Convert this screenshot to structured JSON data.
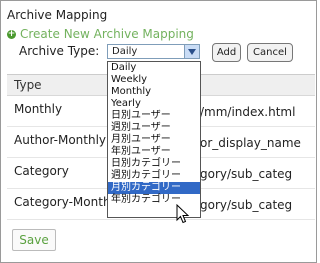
{
  "page": {
    "title": "Archive Mapping",
    "create_link": "Create New Archive Mapping"
  },
  "form": {
    "archive_type_label": "Archive Type:",
    "selected_value": "Daily",
    "add_label": "Add",
    "cancel_label": "Cancel"
  },
  "dropdown": {
    "options": [
      "Daily",
      "Weekly",
      "Monthly",
      "Yearly",
      "日別ユーザー",
      "週別ユーザー",
      "月別ユーザー",
      "年別ユーザー",
      "日別カテゴリー",
      "週別カテゴリー",
      "月別カテゴリー",
      "年別カテゴリー"
    ],
    "highlighted_index": 10
  },
  "table": {
    "header_type": "Type",
    "rows": [
      {
        "type": "Monthly",
        "path": "/mm/index.html"
      },
      {
        "type": "Author-Monthly",
        "path": "or_display_name"
      },
      {
        "type": "Category",
        "path": "gory/sub_categ"
      },
      {
        "type": "Category-Monthly",
        "path": "gory/sub_categ"
      }
    ]
  },
  "footer": {
    "save_label": "Save"
  },
  "colors": {
    "link_green": "#73b25e",
    "save_green": "#5aa13f",
    "highlight_blue": "#3169c6"
  }
}
